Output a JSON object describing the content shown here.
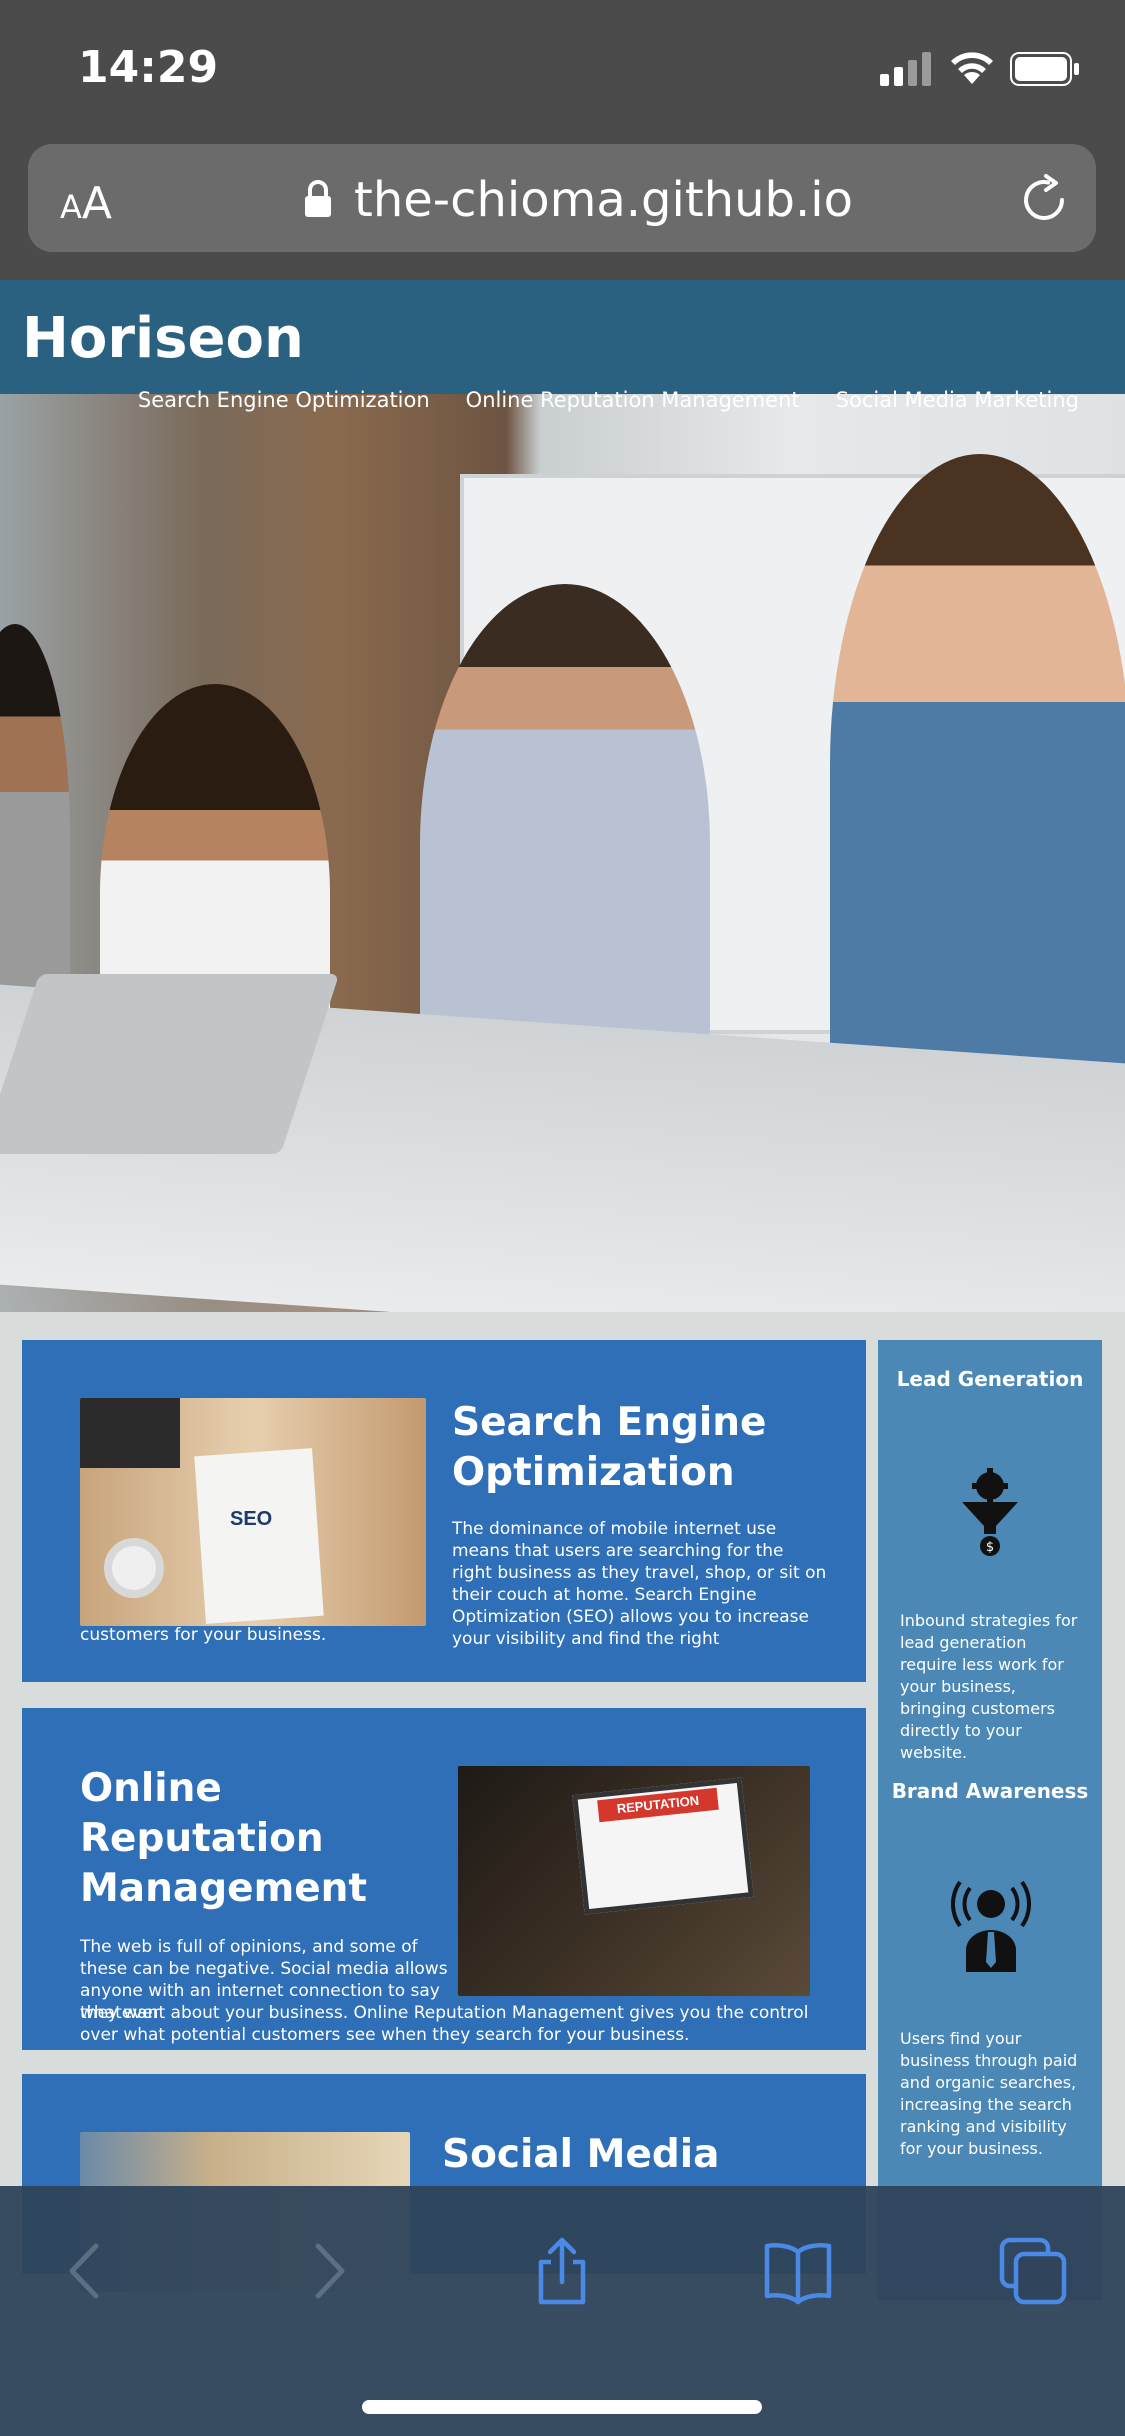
{
  "status_bar": {
    "time": "14:29"
  },
  "browser": {
    "text_size_label_small": "A",
    "text_size_label_large": "A",
    "url": "the-chioma.github.io"
  },
  "site": {
    "brand": "Horiseon",
    "nav": [
      "Search Engine Optimization",
      "Online Reputation Management",
      "Social Media Marketing"
    ]
  },
  "content": {
    "seo": {
      "title": "Search Engine Optimization",
      "text_top": "The dominance of mobile internet use means that users are searching for the right business as they travel, shop, or sit on their couch at home. Search Engine Optimization (SEO) allows you to increase your visibility and find the right",
      "text_bottom": "customers for your business."
    },
    "orm": {
      "title": "Online Reputation Management",
      "text_top": "The web is full of opinions, and some of these can be negative. Social media allows anyone with an internet connection to say whatever",
      "text_bottom": "they want about your business. Online Reputation Management gives you the control over what potential customers see when they search for your business."
    },
    "smm": {
      "title": "Social Media"
    }
  },
  "images": {
    "seo_note": "SEO",
    "rep_banner": "REPUTATION"
  },
  "sidebar": {
    "lead": {
      "title": "Lead Generation",
      "text": "Inbound strategies for lead generation require less work for your business, bringing customers directly to your website."
    },
    "brand": {
      "title": "Brand Awareness",
      "text": "Users find your business through paid and organic searches, increasing the search ranking and visibility for your business."
    }
  },
  "colors": {
    "header": "#2a6180",
    "card": "#2e6fb8",
    "sidebar": "#4b88b5",
    "toolbar": "#30455c"
  },
  "icons": [
    "lock-icon",
    "reload-icon",
    "back-icon",
    "forward-icon",
    "share-icon",
    "bookmarks-icon",
    "tabs-icon"
  ]
}
